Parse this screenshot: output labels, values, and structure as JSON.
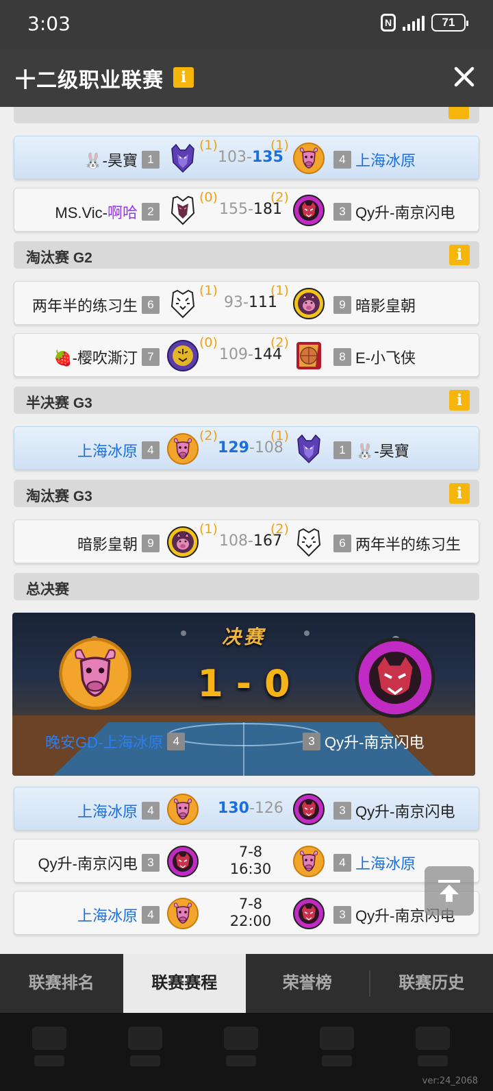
{
  "status": {
    "time": "3:03",
    "battery": "71"
  },
  "header": {
    "title": "十二级职业联赛",
    "info": "i"
  },
  "sections": {
    "g2": "淘汰赛 G2",
    "semi": "半决赛 G3",
    "g3": "淘汰赛 G3",
    "final": "总决赛"
  },
  "matches": [
    {
      "left": {
        "name": "🐰-昊寶",
        "seed": "1"
      },
      "right": {
        "name": "上海冰原",
        "seed": "4"
      },
      "score_l": "103",
      "score_r": "135",
      "wins_l": "(1)",
      "wins_r": "(1)"
    },
    {
      "left": {
        "name_a": "MS.Vic-",
        "name_b": "啊哈",
        "seed": "2"
      },
      "right": {
        "name": "Qy升-南京闪电",
        "seed": "3"
      },
      "score_l": "155",
      "score_r": "181",
      "wins_l": "(0)",
      "wins_r": "(2)"
    },
    {
      "left": {
        "name": "两年半的练习生",
        "seed": "6"
      },
      "right": {
        "name": "暗影皇朝",
        "seed": "9"
      },
      "score_l": "93",
      "score_r": "111",
      "wins_l": "(1)",
      "wins_r": "(1)"
    },
    {
      "left": {
        "name": "🍓-樱吹澌汀",
        "seed": "7"
      },
      "right": {
        "name": "E-小飞侠",
        "seed": "8"
      },
      "score_l": "109",
      "score_r": "144",
      "wins_l": "(0)",
      "wins_r": "(2)"
    },
    {
      "left": {
        "name": "上海冰原",
        "seed": "4"
      },
      "right": {
        "name": "🐰-昊寶",
        "seed": "1"
      },
      "score_l": "129",
      "score_r": "108",
      "wins_l": "(2)",
      "wins_r": "(1)"
    },
    {
      "left": {
        "name": "暗影皇朝",
        "seed": "9"
      },
      "right": {
        "name": "两年半的练习生",
        "seed": "6"
      },
      "score_l": "108",
      "score_r": "167",
      "wins_l": "(1)",
      "wins_r": "(2)"
    }
  ],
  "finals": {
    "title": "决赛",
    "score": "1 - 0",
    "left": {
      "name": "晚安GD-上海冰原",
      "seed": "4"
    },
    "right": {
      "name": "Qy升-南京闪电",
      "seed": "3"
    }
  },
  "final_games": [
    {
      "left": {
        "name": "上海冰原",
        "seed": "4"
      },
      "right": {
        "name": "Qy升-南京闪电",
        "seed": "3"
      },
      "score_l": "130",
      "score_r": "126"
    },
    {
      "left": {
        "name": "Qy升-南京闪电",
        "seed": "3"
      },
      "right": {
        "name": "上海冰原",
        "seed": "4"
      },
      "date": "7-8",
      "time": "16:30"
    },
    {
      "left": {
        "name": "上海冰原",
        "seed": "4"
      },
      "right": {
        "name": "Qy升-南京闪电",
        "seed": "3"
      },
      "date": "7-8",
      "time": "22:00"
    }
  ],
  "score_sep": "-",
  "tabs": [
    "联赛排名",
    "联赛赛程",
    "荣誉榜",
    "联赛历史"
  ],
  "version": "ver:24_2068",
  "colors": {
    "accent": "#f5b50a",
    "blue": "#1a6fe0",
    "purple": "#9b2ff2",
    "wins": "#f0a010"
  }
}
